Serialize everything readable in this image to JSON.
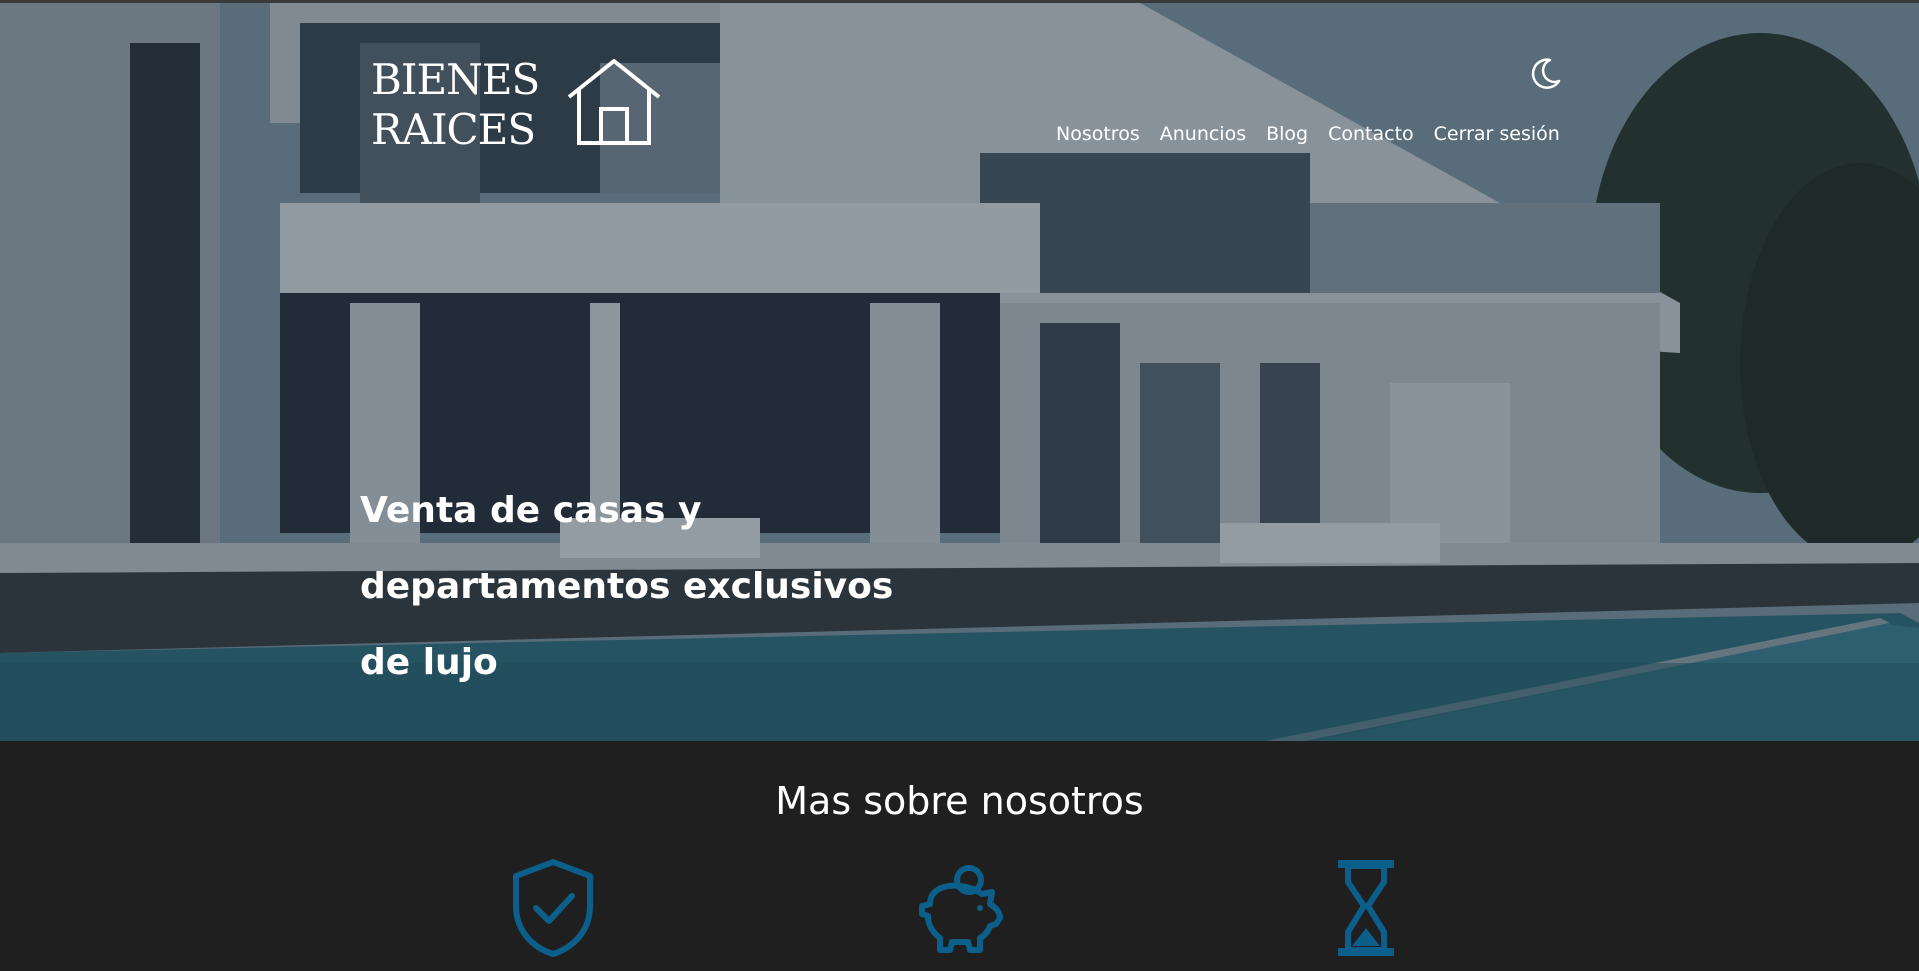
{
  "brand": {
    "line1": "BIENES",
    "line2": "RAICES",
    "logo_icon": "house-outline-icon"
  },
  "header": {
    "theme_toggle_icon": "moon-icon",
    "nav": [
      {
        "label": "Nosotros"
      },
      {
        "label": "Anuncios"
      },
      {
        "label": "Blog"
      },
      {
        "label": "Contacto"
      },
      {
        "label": "Cerrar sesión"
      }
    ]
  },
  "hero": {
    "headline": "Venta de casas y departamentos exclusivos de lujo"
  },
  "about": {
    "title": "Mas sobre nosotros",
    "features": [
      {
        "icon": "shield-check-icon"
      },
      {
        "icon": "piggy-bank-icon"
      },
      {
        "icon": "hourglass-icon"
      }
    ]
  },
  "colors": {
    "accent": "#0b5f8a",
    "dark_bg": "#1f1f1f",
    "text_light": "#ffffff"
  }
}
